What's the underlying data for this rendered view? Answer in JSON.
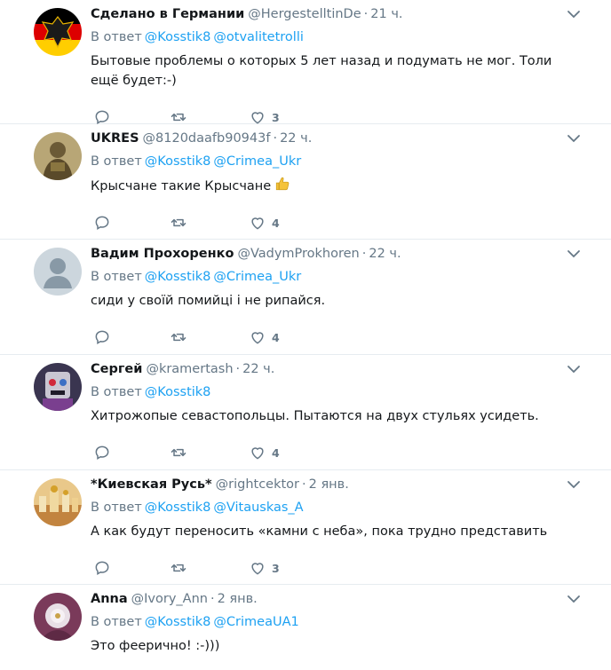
{
  "reply_prefix": "В ответ",
  "tweets": [
    {
      "name": "Сделано в Германии",
      "handle": "@HergestelltinDe",
      "time": "21 ч.",
      "mentions": [
        "@Kosstik8",
        "@otvalitetrolli"
      ],
      "text": "Бытовые проблемы о которых 5 лет назад и подумать не мог. Толи ещё будет:-)",
      "likes": "3",
      "avatar_icon": "german-eagle-avatar"
    },
    {
      "name": "UKRES",
      "handle": "@8120daafb90943f",
      "time": "22 ч.",
      "mentions": [
        "@Kosstik8",
        "@Crimea_Ukr"
      ],
      "text": "Крысчане такие Крысчане",
      "emoji": "thumbs-up",
      "likes": "4",
      "avatar_icon": "soldier-avatar"
    },
    {
      "name": "Вадим Прохоренко",
      "handle": "@VadymProkhoren",
      "time": "22 ч.",
      "mentions": [
        "@Kosstik8",
        "@Crimea_Ukr"
      ],
      "text": "сиди у своїй помийці і не рипайся.",
      "likes": "4",
      "avatar_icon": "default-user-avatar"
    },
    {
      "name": "Сергей",
      "handle": "@kramertash",
      "time": "22 ч.",
      "mentions": [
        "@Kosstik8"
      ],
      "text": "Хитрожопые севастопольцы. Пытаются на двух стульях усидеть.",
      "likes": "4",
      "avatar_icon": "robot-avatar"
    },
    {
      "name": "*Киевская Русь*",
      "handle": "@rightcektor",
      "time": "2 янв.",
      "mentions": [
        "@Kosstik8",
        "@Vitauskas_A"
      ],
      "text": "А как будут переносить «камни с неба», пока трудно представить",
      "likes": "3",
      "avatar_icon": "city-painting-avatar"
    },
    {
      "name": "Anna",
      "handle": "@Ivory_Ann",
      "time": "2 янв.",
      "mentions": [
        "@Kosstik8",
        "@CrimeaUA1"
      ],
      "text": "Это феерично! :-)))",
      "likes": "",
      "avatar_icon": "flower-avatar"
    }
  ],
  "colors": {
    "link": "#1da1f2",
    "muted": "#657786",
    "text": "#14171a",
    "divider": "#e6ecf0"
  }
}
